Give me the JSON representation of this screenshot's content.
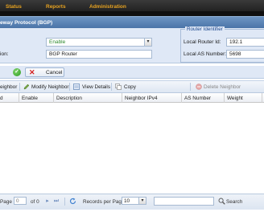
{
  "nav": {
    "items": [
      "Status",
      "Reports",
      "Administration"
    ]
  },
  "panel": {
    "title": "eway Protocol (BGP)"
  },
  "form": {
    "enable_value": "Enable",
    "description_label": "ion:",
    "description_value": "BGP Router",
    "router_identifier_legend": "Router Identifier",
    "local_router_id_label": "Local Router Id:",
    "local_router_id_value": "192.1",
    "local_as_label": "Local AS Number:",
    "local_as_value": "5698"
  },
  "buttons": {
    "cancel": "Cancel"
  },
  "toolbar": {
    "add_neighbor": "eighbor",
    "modify_neighbor": "Modify Neighbor",
    "view_details": "View Details",
    "copy": "Copy",
    "delete_neighbor": "Delete Neighbor"
  },
  "grid": {
    "columns": [
      "d",
      "Enable",
      "Description",
      "Neighbor IPv4",
      "AS Number",
      "Weight"
    ]
  },
  "pager": {
    "page_label": "Page",
    "page_value": "0",
    "of_label": "of 0",
    "records_label": "Records per Page",
    "records_value": "10",
    "search_label": "Search"
  },
  "colors": {
    "nav_text": "#e8a320",
    "header_blue": "#5a82b4",
    "form_bg": "#dfe8f6",
    "enable_green": "#2e8a2e",
    "cancel_red": "#d42020"
  }
}
